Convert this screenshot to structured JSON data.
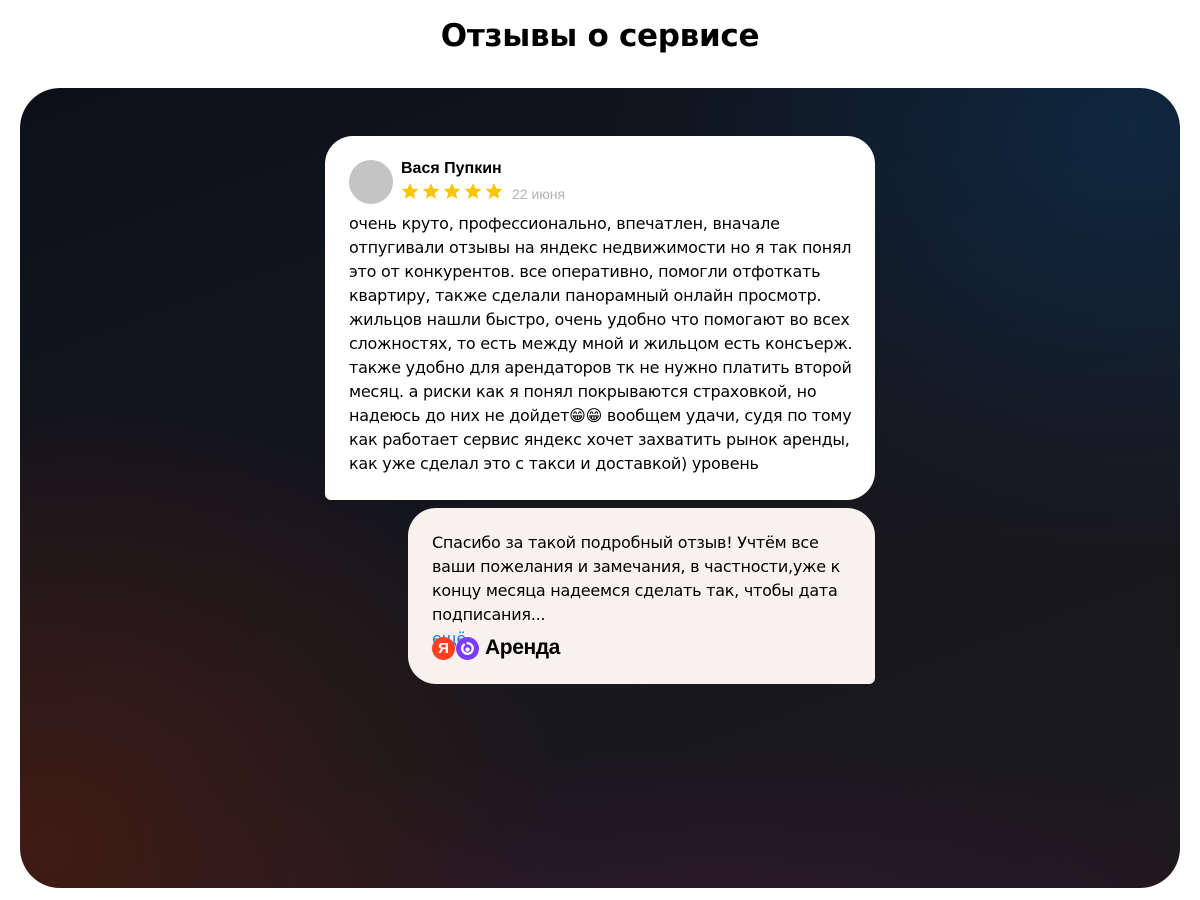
{
  "page": {
    "title": "Отзывы о сервисе"
  },
  "review": {
    "author": "Вася Пупкин",
    "rating": 5,
    "rating_max": 5,
    "star_color": "#fbc400",
    "date": "22 июня",
    "text": "очень круто, профессионально, впечатлен, вначале отпугивали отзывы на яндекс недвижимости но я так понял это от конкурентов. все оперативно, помогли отфоткать квартиру, также сделали панорамный онлайн просмотр. жильцов нашли быстро, очень удобно что помогают во всех сложностях, то есть между мной и жильцом есть консъерж. также удобно для арендаторов тк не нужно платить второй месяц. а риски как я понял покрываются страховкой, но надеюсь до них не дойдет😁😁 вообщем удачи, судя по тому как работает сервис яндекс хочет захватить рынок аренды, как уже сделал это с такси и доставкой) уровень"
  },
  "reply": {
    "text": "Спасибо за такой подробный отзыв! Учтём все ваши пожелания и замечания, в частности,уже к концу месяца надеемся сделать так, чтобы дата подписания...",
    "more_label": "ещё",
    "more_color": "#1a78e6",
    "brand_logo_letter": "Я",
    "brand_name": "Аренда",
    "brand_colors": {
      "yandex": "#fc3f1d",
      "arenda": "#7b3cf5"
    }
  }
}
